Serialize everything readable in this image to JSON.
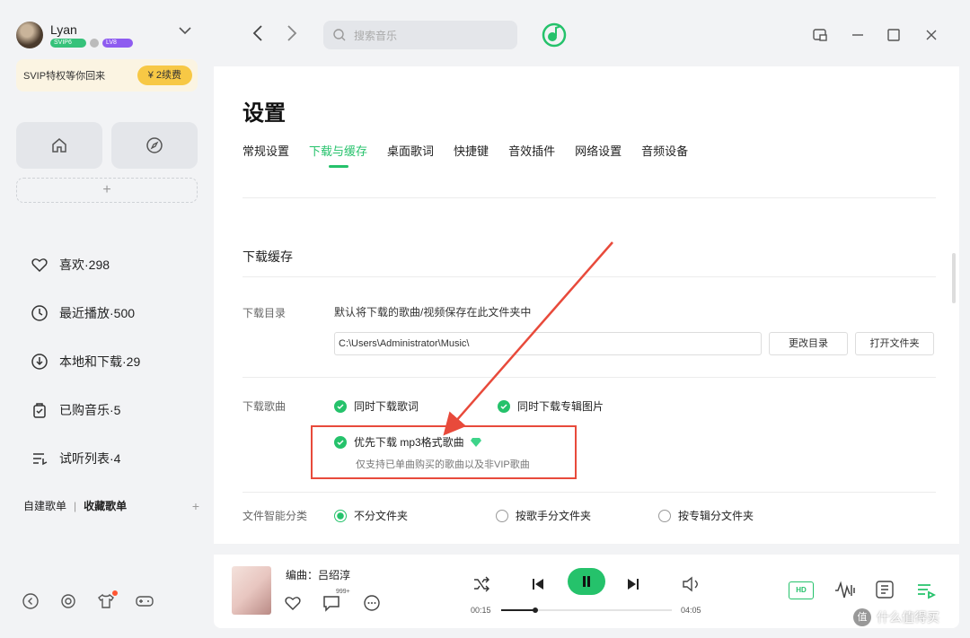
{
  "user": {
    "name": "Lyan",
    "badge1": "SVIP6",
    "badge3": "LV8"
  },
  "svip": {
    "text": "SVIP特权等你回来",
    "button": "¥ 2续费"
  },
  "sidebar": {
    "items": [
      {
        "label": "喜欢·298"
      },
      {
        "label": "最近播放·500"
      },
      {
        "label": "本地和下载·29"
      },
      {
        "label": "已购音乐·5"
      },
      {
        "label": "试听列表·4"
      }
    ],
    "playlist_tabs": {
      "created": "自建歌单",
      "sep": "|",
      "collected": "收藏歌单",
      "add": "+"
    }
  },
  "search": {
    "placeholder": "搜索音乐"
  },
  "page": {
    "title": "设置",
    "tabs": [
      {
        "label": "常规设置"
      },
      {
        "label": "下载与缓存",
        "active": true
      },
      {
        "label": "桌面歌词"
      },
      {
        "label": "快捷键"
      },
      {
        "label": "音效插件"
      },
      {
        "label": "网络设置"
      },
      {
        "label": "音频设备"
      }
    ]
  },
  "download": {
    "section_title": "下载缓存",
    "dir_label": "下载目录",
    "dir_desc": "默认将下载的歌曲/视频保存在此文件夹中",
    "dir_path": "C:\\Users\\Administrator\\Music\\",
    "change_dir": "更改目录",
    "open_folder": "打开文件夹",
    "songs_label": "下载歌曲",
    "opt_lyrics": "同时下载歌词",
    "opt_cover": "同时下载专辑图片",
    "opt_mp3": "优先下载 mp3格式歌曲",
    "opt_mp3_sub": "仅支持已单曲购买的歌曲以及非VIP歌曲",
    "classify_label": "文件智能分类",
    "radio_none": "不分文件夹",
    "radio_artist": "按歌手分文件夹",
    "radio_album": "按专辑分文件夹"
  },
  "player": {
    "song": "编曲：吕绍淳",
    "comment_count": "999+",
    "time_current": "00:15",
    "time_total": "04:05",
    "progress": 0.2,
    "hd": "HD"
  },
  "watermark": {
    "icon": "值",
    "text": "什么值得买"
  },
  "colors": {
    "accent": "#25c26b",
    "highlight": "#e84a3b"
  }
}
